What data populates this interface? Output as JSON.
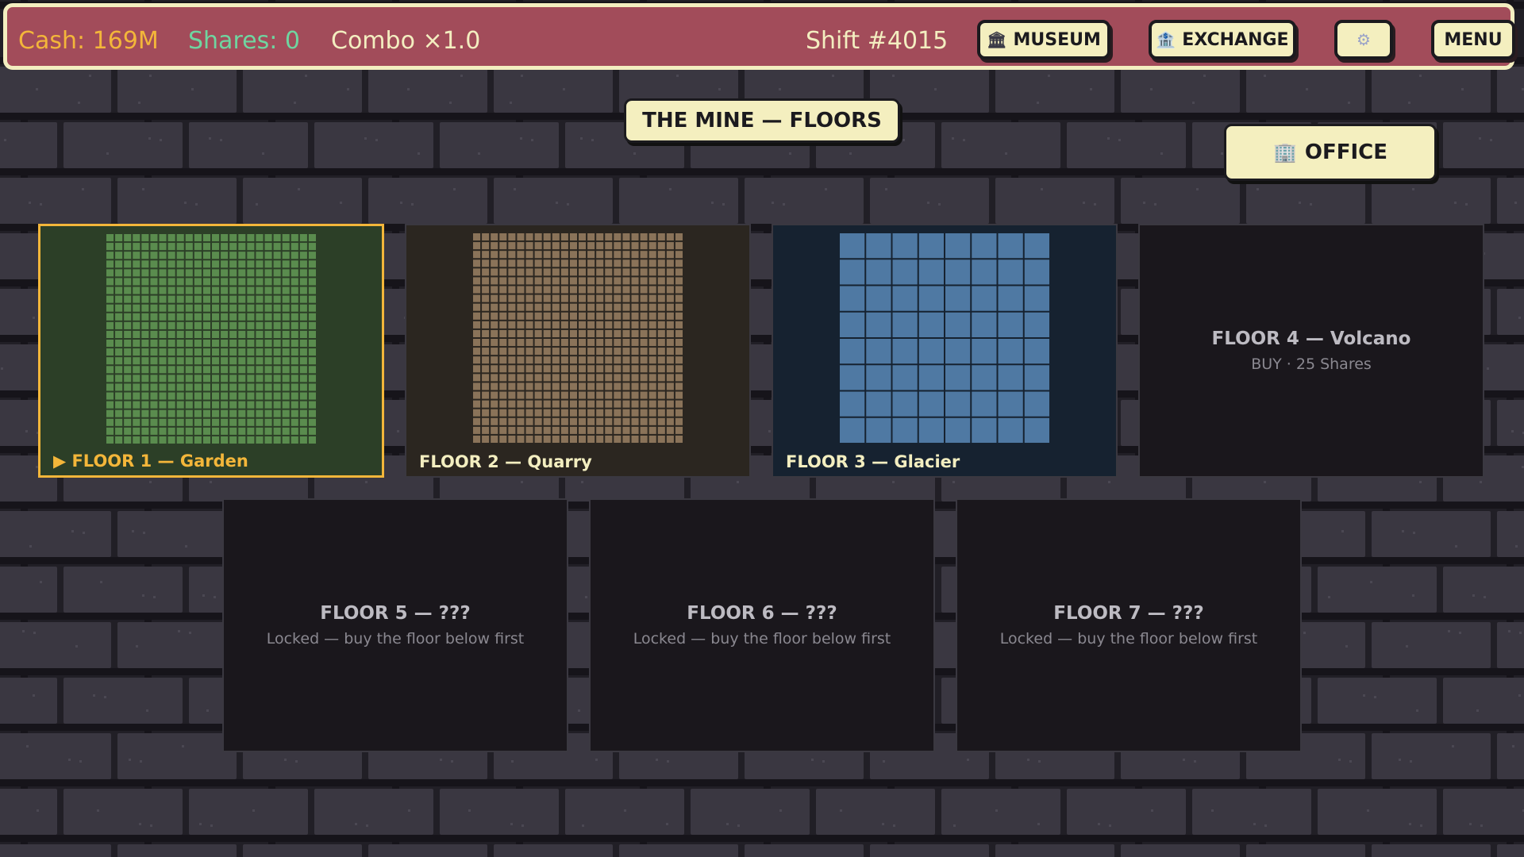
{
  "topbar": {
    "cash": "Cash: 169M",
    "shares": "Shares: 0",
    "combo": "Combo ×1.0",
    "shift": "Shift #4015",
    "museum_label": "MUSEUM",
    "museum_icon": "museum-icon",
    "exchange_label": "EXCHANGE",
    "exchange_icon": "bank-icon",
    "settings_icon": "gear-icon",
    "menu_label": "MENU"
  },
  "title": "THE MINE — FLOORS",
  "office": {
    "label": "OFFICE",
    "icon": "building-icon"
  },
  "floors": [
    {
      "label": "▶ FLOOR 1 — Garden",
      "state": "owned-active",
      "color": "#5a8c4e",
      "bg": "#2c3f27",
      "label_color": "#f3b63a",
      "grid_cells": 24
    },
    {
      "label": "FLOOR 2 — Quarry",
      "state": "owned",
      "color": "#8a7359",
      "bg": "#2b2620",
      "label_color": "#f3eec0",
      "grid_cells": 24
    },
    {
      "label": "FLOOR 3 — Glacier",
      "state": "owned",
      "color": "#4f79a3",
      "bg": "#162230",
      "label_color": "#f3eec0",
      "grid_cells": 8
    },
    {
      "name": "FLOOR 4 — Volcano",
      "sub": "BUY · 25 Shares",
      "state": "buyable",
      "bg": "#1a171c"
    },
    {
      "name": "FLOOR 5 — ???",
      "sub": "Locked — buy the floor below first",
      "state": "locked",
      "bg": "#1a171c"
    },
    {
      "name": "FLOOR 6 — ???",
      "sub": "Locked — buy the floor below first",
      "state": "locked",
      "bg": "#1a171c"
    },
    {
      "name": "FLOOR 7 — ???",
      "sub": "Locked — buy the floor below first",
      "state": "locked",
      "bg": "#1a171c"
    }
  ],
  "colors": {
    "topbar": "#a24c5a",
    "button": "#f4efbf",
    "accent": "#f3b63a",
    "shares": "#6fd5a0"
  }
}
